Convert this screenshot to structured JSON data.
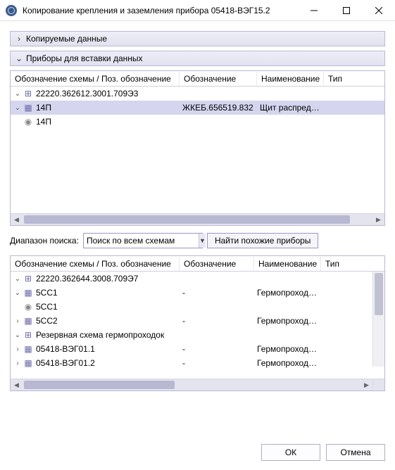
{
  "window": {
    "title": "Копирование крепления и заземления прибора 05418-ВЭГ15.2",
    "min": "—",
    "max": "□",
    "close": "✕"
  },
  "accordion": {
    "copied_data": "Копируемые данные",
    "target_devices": "Приборы для вставки данных"
  },
  "columns": {
    "schema": "Обозначение схемы / Поз. обозначение",
    "designation": "Обозначение",
    "name": "Наименование",
    "type": "Тип"
  },
  "tree1": {
    "r1": "22220.362612.3001.709Э3",
    "r2": "14П",
    "r2_des": "ЖКЕБ.656519.832",
    "r2_name": "Щит распреде...",
    "r3": "14П"
  },
  "search": {
    "label": "Диапазон поиска:",
    "value": "Поиск по всем схемам",
    "button": "Найти похожие приборы"
  },
  "tree2": {
    "r1": "22220.362644.3008.709Э7",
    "r2": "5CC1",
    "r2_des": "-",
    "r2_name": "Гермопроходк...",
    "r3": "5CC1",
    "r4": "5CC2",
    "r4_des": "-",
    "r4_name": "Гермопроходк...",
    "r5": "Резервная схема гермопроходок",
    "r6": "05418-ВЭГ01.1",
    "r6_des": "-",
    "r6_name": "Гермопроходк...",
    "r7": "05418-ВЭГ01.2",
    "r7_des": "-",
    "r7_name": "Гермопроходк..."
  },
  "footer": {
    "ok": "ОК",
    "cancel": "Отмена"
  },
  "glyph": {
    "chev_right": "›",
    "chev_down": "⌄",
    "schema": "⊞",
    "device": "▦",
    "terminal": "◉",
    "tri_left": "◀",
    "tri_right": "▶",
    "tri_down": "▼"
  }
}
